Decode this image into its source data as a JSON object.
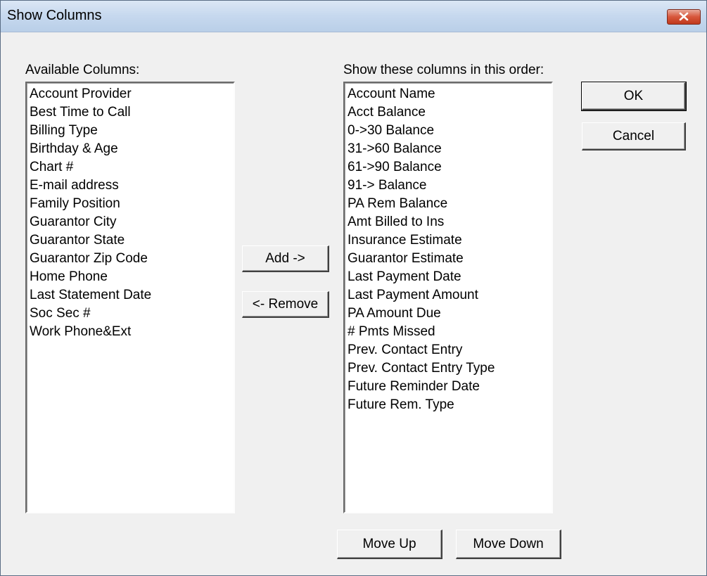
{
  "window": {
    "title": "Show Columns"
  },
  "available": {
    "label": "Available Columns:",
    "items": [
      "Account Provider",
      "Best Time to Call",
      "Billing Type",
      "Birthday & Age",
      "Chart #",
      "E-mail address",
      "Family Position",
      "Guarantor City",
      "Guarantor State",
      "Guarantor Zip Code",
      "Home Phone",
      "Last Statement Date",
      "Soc Sec #",
      "Work Phone&Ext"
    ]
  },
  "shown": {
    "label": "Show these columns in this order:",
    "items": [
      "Account Name",
      "Acct Balance",
      "0->30 Balance",
      "31->60 Balance",
      "61->90 Balance",
      "91-> Balance",
      "PA Rem Balance",
      "Amt Billed to Ins",
      "Insurance Estimate",
      "Guarantor Estimate",
      "Last Payment Date",
      "Last Payment Amount",
      "PA Amount Due",
      "# Pmts Missed",
      "Prev. Contact Entry",
      "Prev. Contact Entry Type",
      "Future Reminder Date",
      "Future Rem. Type"
    ]
  },
  "buttons": {
    "add": "Add ->",
    "remove": "<- Remove",
    "ok": "OK",
    "cancel": "Cancel",
    "move_up": "Move Up",
    "move_down": "Move Down"
  },
  "icons": {
    "close": "close-icon"
  },
  "colors": {
    "close_button": "#c0391c",
    "title_bar": "#c6d8ee"
  }
}
